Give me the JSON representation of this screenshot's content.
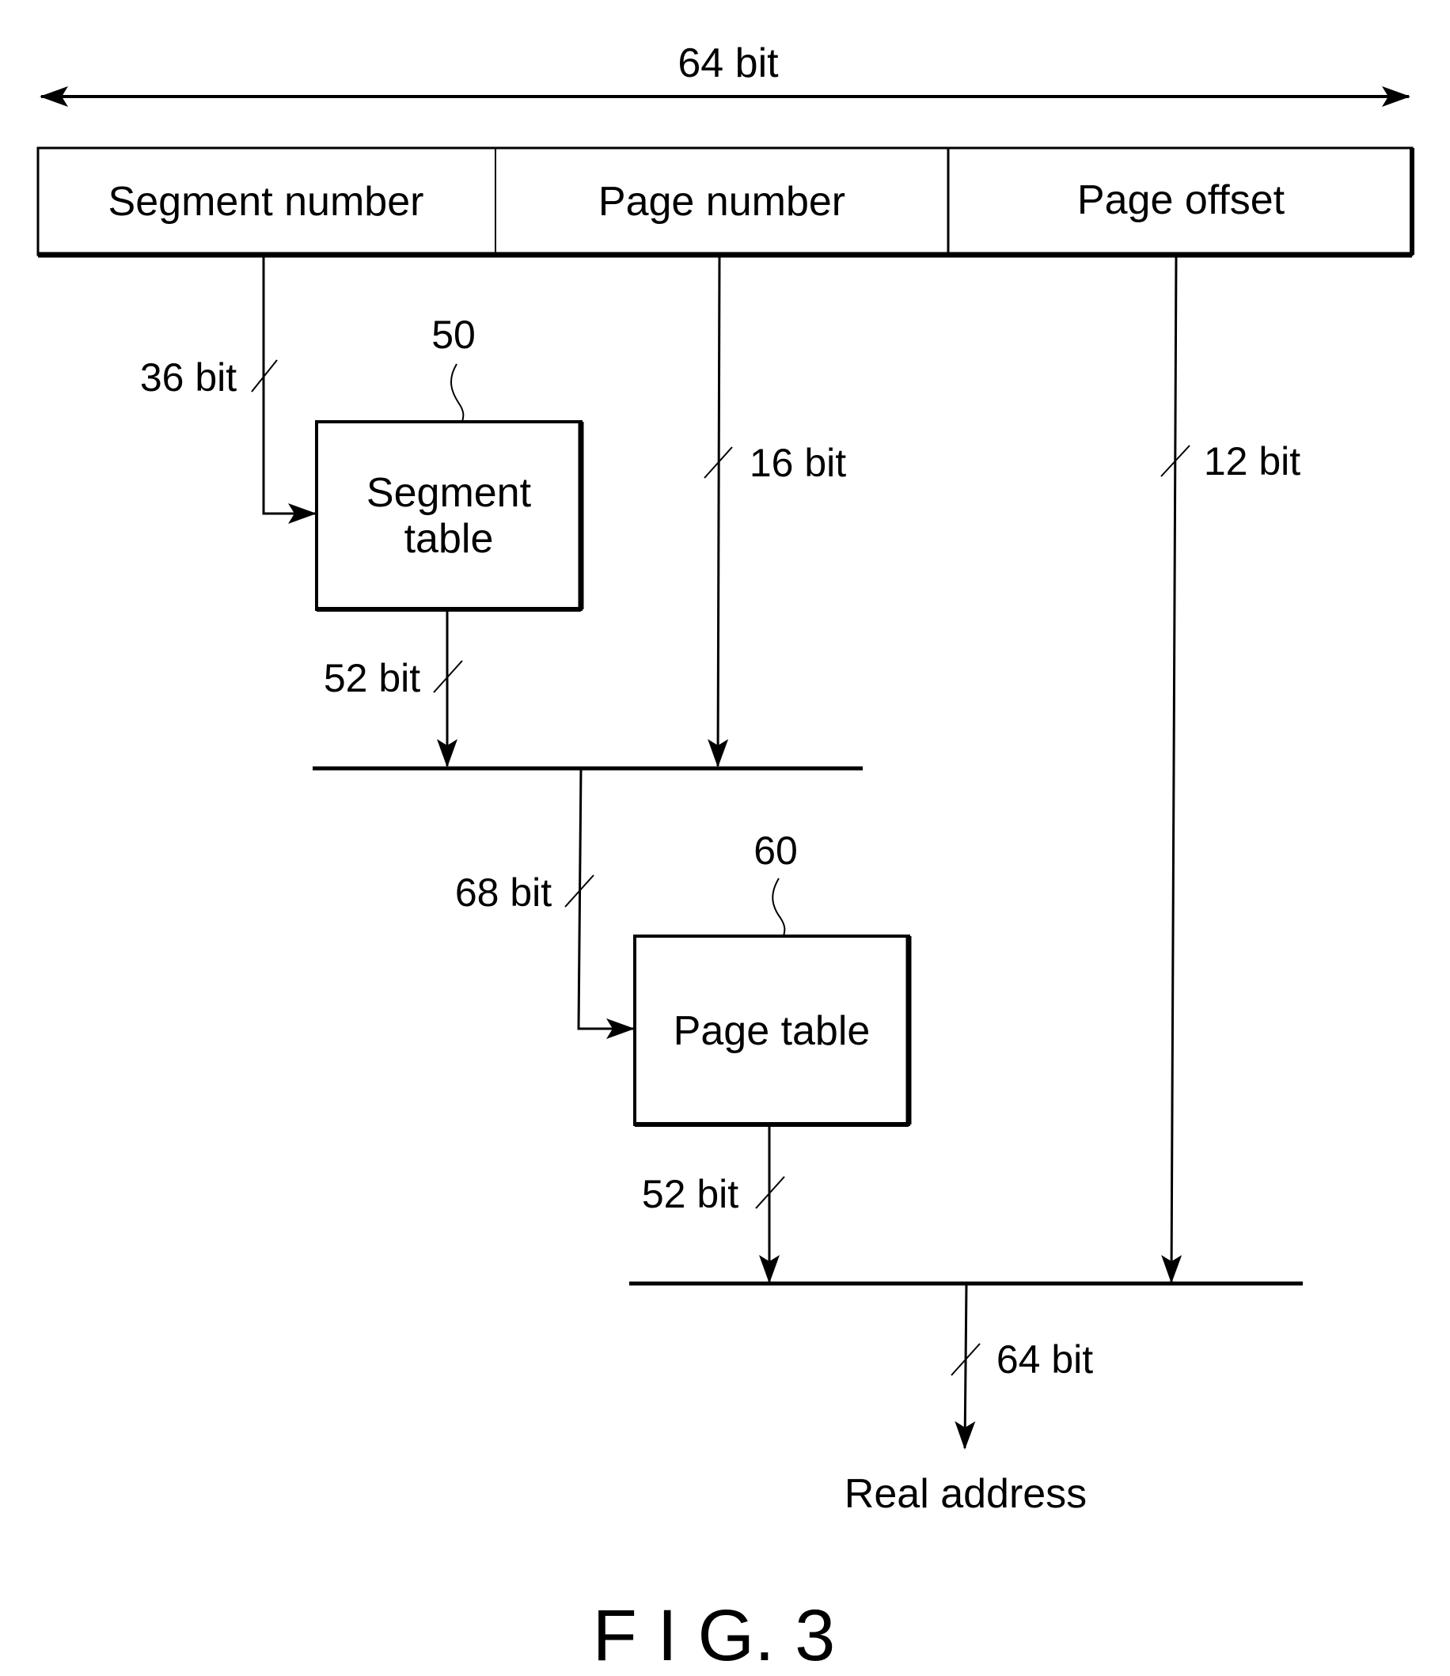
{
  "figure": {
    "caption": "F I G. 3",
    "total_width_label": "64 bit"
  },
  "address_fields": [
    {
      "label": "Segment number"
    },
    {
      "label": "Page number"
    },
    {
      "label": "Page offset"
    }
  ],
  "blocks": {
    "segment_table": {
      "line1": "Segment",
      "line2": "table",
      "ref": "50"
    },
    "page_table": {
      "label": "Page table",
      "ref": "60"
    }
  },
  "bus_widths": {
    "segment_in": "36 bit",
    "page_number": "16 bit",
    "page_offset": "12 bit",
    "segment_out": "52 bit",
    "combined": "68 bit",
    "page_out": "52 bit",
    "real": "64 bit"
  },
  "output": {
    "label": "Real address"
  }
}
